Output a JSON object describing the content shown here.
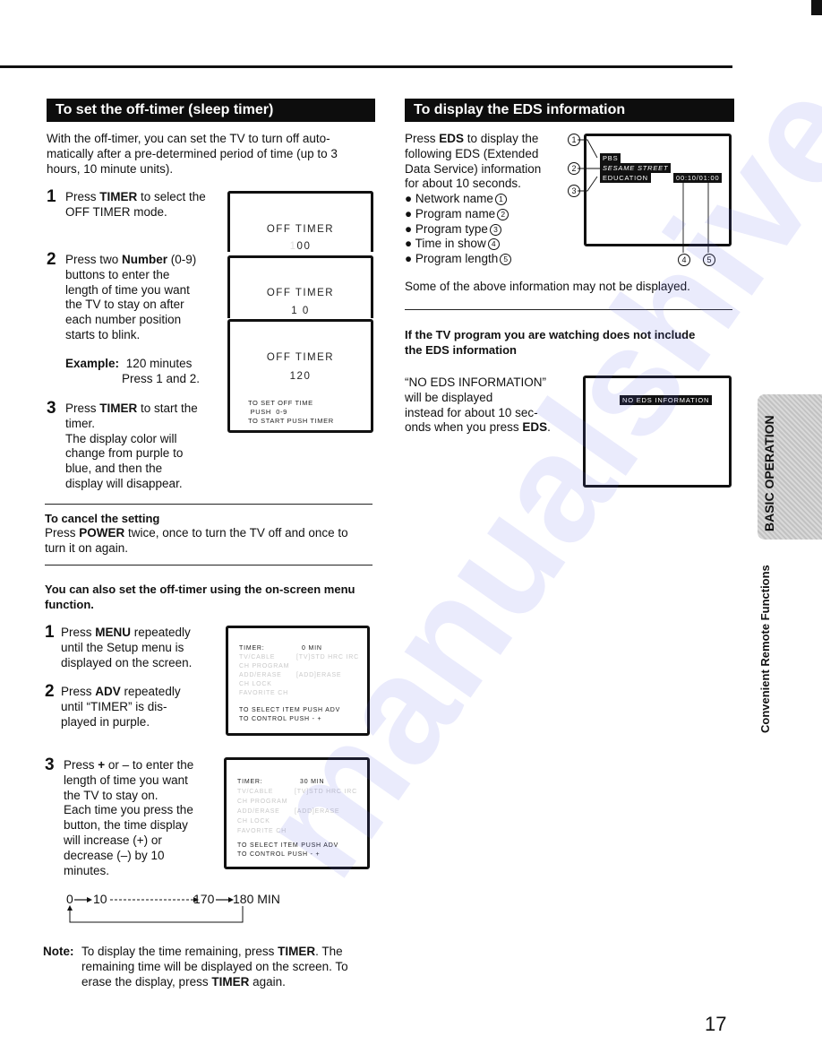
{
  "page": {
    "number": "17",
    "side_tab": "BASIC OPERATION",
    "side_chapter": "Convenient Remote Functions",
    "watermark": "manualshive.com"
  },
  "sleep_timer": {
    "title": "To set the off-timer (sleep timer)",
    "intro": "With the off-timer, you can set the TV to turn off auto- matically after a pre-determined period of time (up to 3 hours, 10 minute units).",
    "intro_lines": [
      "With the off-timer, you can set the TV to turn off auto-",
      "matically after a pre-determined period of time (up to 3",
      "hours, 10 minute units)."
    ],
    "steps": [
      {
        "num": "1",
        "lines": [
          [
            "Press ",
            "TIMER",
            " to select the"
          ],
          [
            "OFF TIMER mode.",
            "",
            ""
          ]
        ]
      },
      {
        "num": "2",
        "lines": [
          [
            "Press two ",
            "Number",
            " (0-9)"
          ],
          [
            "buttons to enter the",
            "",
            ""
          ],
          [
            "length of time you want",
            "",
            ""
          ],
          [
            "the TV to stay on after",
            "",
            ""
          ],
          [
            "each number position",
            "",
            ""
          ],
          [
            "starts to blink.",
            "",
            ""
          ]
        ]
      },
      {
        "num": "3",
        "lines": [
          [
            "Press ",
            "TIMER",
            " to start the"
          ],
          [
            "timer.",
            "",
            ""
          ],
          [
            "The display color will",
            "",
            ""
          ],
          [
            "change from purple to",
            "",
            ""
          ],
          [
            "blue, and then the",
            "",
            ""
          ],
          [
            "display will disappear.",
            "",
            ""
          ]
        ]
      }
    ],
    "example_label": "Example:",
    "example_value": "120 minutes",
    "example_detail": "Press 1 and 2.",
    "screens": [
      {
        "title": "OFF TIMER",
        "value": "00",
        "blink_digit": "1"
      },
      {
        "title": "OFF TIMER",
        "value": "1 0"
      },
      {
        "title": "OFF TIMER",
        "value": "120",
        "help": [
          "TO SET OFF TIME",
          " PUSH  0-9",
          "TO START PUSH TIMER"
        ]
      }
    ],
    "cancel": {
      "heading": "To cancel the setting",
      "line1_pre": "Press ",
      "line1_bold": "POWER",
      "line1_post": " twice, once to turn the TV off and once to",
      "line2": "turn it on again."
    }
  },
  "menu_method": {
    "heading_lines": [
      "You can also set the off-timer using the on-screen menu",
      "function."
    ],
    "steps": [
      {
        "num": "1",
        "lines": [
          [
            "Press ",
            "MENU",
            " repeatedly"
          ],
          [
            "until the Setup menu is",
            "",
            ""
          ],
          [
            "displayed on the screen.",
            "",
            ""
          ]
        ]
      },
      {
        "num": "2",
        "lines": [
          [
            "Press ",
            "ADV",
            " repeatedly"
          ],
          [
            "until “TIMER” is dis-",
            "",
            ""
          ],
          [
            "played in purple.",
            "",
            ""
          ]
        ]
      },
      {
        "num": "3",
        "lines": [
          [
            "Press ",
            "+",
            " or – to enter the"
          ],
          [
            "length of time you want",
            "",
            ""
          ],
          [
            "the TV to stay on.",
            "",
            ""
          ],
          [
            "Each time you press the",
            "",
            ""
          ],
          [
            "button, the time display",
            "",
            ""
          ],
          [
            "will increase (+) or",
            "",
            ""
          ],
          [
            "decrease (–) by 10",
            "",
            ""
          ],
          [
            "minutes.",
            "",
            ""
          ]
        ]
      }
    ],
    "screens": [
      {
        "timer_label": "TIMER:",
        "timer_value": "0 MIN"
      },
      {
        "timer_label": "TIMER:",
        "timer_value": "30 MIN"
      }
    ],
    "menu_items": [
      {
        "label": "TV/CABLE",
        "value": "[TV]STD HRC IRC"
      },
      {
        "label": "CH PROGRAM",
        "value": ""
      },
      {
        "label": "ADD/ERASE",
        "value": "[ADD]ERASE"
      },
      {
        "label": "CH LOCK",
        "value": ""
      },
      {
        "label": "FAVORITE CH",
        "value": ""
      }
    ],
    "menu_help": [
      "TO SELECT ITEM PUSH ADV",
      "TO CONTROL PUSH - +"
    ],
    "cycle": {
      "start": "0",
      "second": "10",
      "penultimate": "170",
      "end": "180 MIN"
    },
    "note": {
      "label": "Note:",
      "lines": [
        [
          "To display the time remaining, press ",
          "TIMER",
          ". The"
        ],
        [
          "remaining time will be displayed on the screen. To",
          "",
          ""
        ],
        [
          "erase the display, press ",
          "TIMER",
          " again."
        ]
      ]
    }
  },
  "eds": {
    "title": "To display the EDS information",
    "intro_lines": [
      [
        "Press ",
        "EDS",
        " to display the"
      ],
      [
        "following EDS (Extended",
        "",
        ""
      ],
      [
        "Data Service) information",
        "",
        ""
      ],
      [
        "for about 10 seconds.",
        "",
        ""
      ]
    ],
    "bullets": [
      {
        "label": "Network name",
        "ref": "1"
      },
      {
        "label": "Program name",
        "ref": "2"
      },
      {
        "label": "Program type",
        "ref": "3"
      },
      {
        "label": "Time in show",
        "ref": "4"
      },
      {
        "label": "Program length",
        "ref": "5"
      }
    ],
    "screen": {
      "network": "PBS",
      "program": "SESAME STREET",
      "type": "EDUCATION",
      "time": "00:10/01:00"
    },
    "disclaimer": "Some of the above information may not be displayed.",
    "no_eds": {
      "heading_lines": [
        "If the TV program you are watching does not include",
        "the EDS information"
      ],
      "lines": [
        [
          "“NO EDS INFORMATION”",
          "",
          ""
        ],
        [
          "will be displayed",
          "",
          ""
        ],
        [
          "instead for about 10 sec-",
          "",
          ""
        ],
        [
          "onds when you press ",
          "EDS",
          "."
        ]
      ],
      "screen_text": "NO EDS INFORMATION"
    }
  }
}
